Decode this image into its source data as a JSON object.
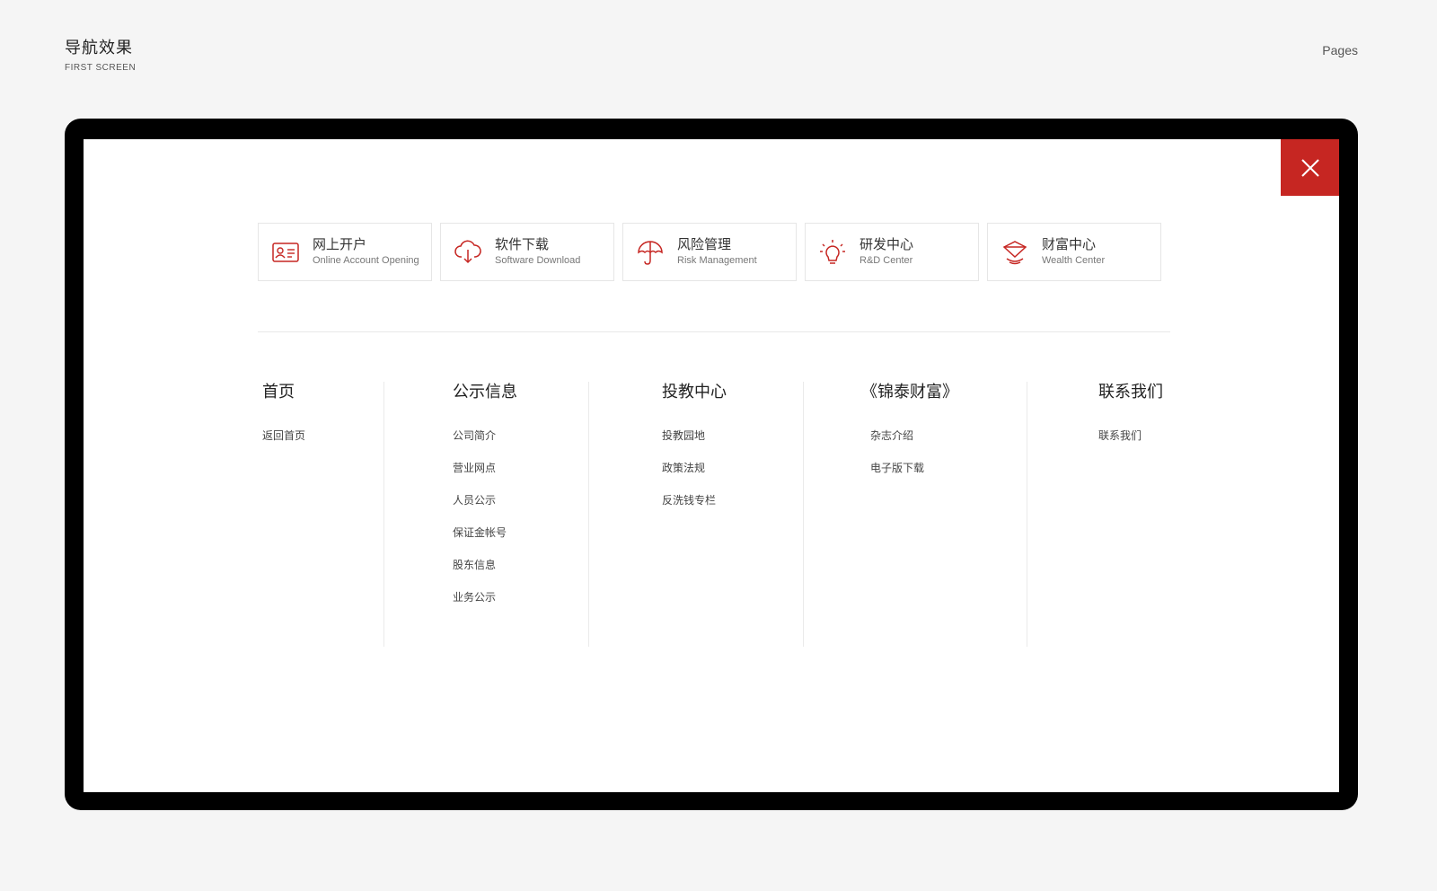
{
  "header": {
    "title": "导航效果",
    "subtitle": "FIRST SCREEN",
    "pages_label": "Pages"
  },
  "close_icon": "close-icon",
  "quick_links": [
    {
      "title": "网上开户",
      "subtitle": "Online Account Opening",
      "icon": "id-card-icon"
    },
    {
      "title": "软件下载",
      "subtitle": "Software Download",
      "icon": "cloud-download-icon"
    },
    {
      "title": "风险管理",
      "subtitle": "Risk Management",
      "icon": "umbrella-icon"
    },
    {
      "title": "研发中心",
      "subtitle": "R&D Center",
      "icon": "lightbulb-icon"
    },
    {
      "title": "财富中心",
      "subtitle": "Wealth Center",
      "icon": "diamond-icon"
    }
  ],
  "nav": {
    "home": {
      "title": "首页",
      "items": [
        "返回首页"
      ]
    },
    "public_info": {
      "title": "公示信息",
      "items": [
        "公司简介",
        "营业网点",
        "人员公示",
        "保证金帐号",
        "股东信息",
        "业务公示"
      ]
    },
    "investor_edu": {
      "title": "投教中心",
      "items": [
        "投教园地",
        "政策法规",
        "反洗钱专栏"
      ]
    },
    "magazine": {
      "title": "《锦泰财富》",
      "items": [
        "杂志介绍",
        "电子版下载"
      ]
    },
    "contact": {
      "title": "联系我们",
      "items": [
        "联系我们"
      ]
    }
  },
  "colors": {
    "accent": "#c62622",
    "background": "#f5f5f5",
    "frame": "#000000"
  }
}
